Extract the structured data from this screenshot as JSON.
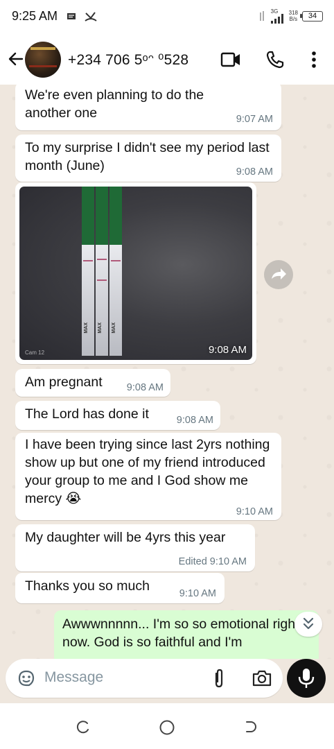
{
  "status_bar": {
    "time": "9:25 AM",
    "network": "3G",
    "speed_value": "318",
    "speed_unit": "B/s",
    "battery": "34"
  },
  "header": {
    "contact": "+234 706 5ᵒᵔ ⁰528"
  },
  "messages": [
    {
      "text": "We're even planning to do the another one",
      "time": "9:07 AM"
    },
    {
      "text": "To my surprise I didn't see my period last month (June)",
      "time": "9:08 AM"
    },
    {
      "type": "image",
      "time": "9:08 AM",
      "watermark": "Cam 12",
      "strip_label": "MAX"
    },
    {
      "text": "Am pregnant",
      "time": "9:08 AM"
    },
    {
      "text": "The Lord has done it",
      "time": "9:08 AM"
    },
    {
      "text": "I have been trying since last 2yrs nothing show up but one of my friend introduced your group to me and I God show me mercy 😭",
      "time": "9:10 AM"
    },
    {
      "text": "My daughter will be 4yrs this year",
      "time": "Edited 9:10 AM"
    },
    {
      "text": "Thanks you so much",
      "time": "9:10 AM"
    },
    {
      "text": "Awwwnnnnn... I'm so so emotional right now. God is so faithful and I'm",
      "outgoing": true
    }
  ],
  "input": {
    "placeholder": "Message"
  },
  "icons": {
    "back": "arrow-left-icon",
    "video": "video-call-icon",
    "call": "phone-icon",
    "menu": "more-vert-icon",
    "emoji": "sticker-icon",
    "attach": "paperclip-icon",
    "camera": "camera-icon",
    "mic": "mic-icon",
    "forward": "forward-icon",
    "scroll": "chevron-double-down-icon"
  },
  "colors": {
    "chat_background": "#efe7de",
    "incoming_bubble": "#ffffff",
    "outgoing_bubble": "#d9fdd3",
    "timestamp": "#667781"
  }
}
